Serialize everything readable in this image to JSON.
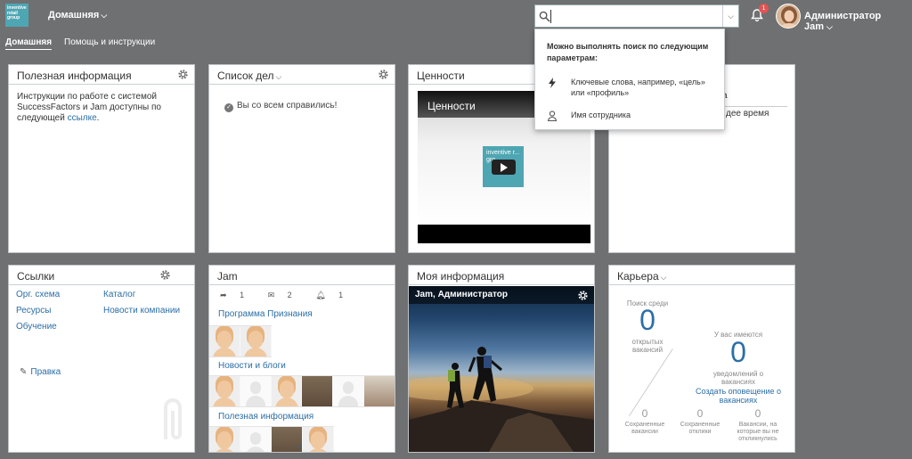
{
  "header": {
    "logo_text": "inventive retail group",
    "home_menu": "Домашняя",
    "search": {
      "value": "",
      "placeholder": ""
    },
    "notification_count": "1",
    "user_name": "Администратор Jam"
  },
  "subnav": {
    "home": "Домашняя",
    "help": "Помощь и инструкции"
  },
  "search_dropdown": {
    "hint": "Можно выполнять поиск по следующим параметрам:",
    "options": [
      {
        "icon": "lightning-icon",
        "text": "Ключевые слова, например, «цель» или «профиль»"
      },
      {
        "icon": "person-icon",
        "text": "Имя сотрудника"
      }
    ]
  },
  "tiles": {
    "useful_info": {
      "title": "Полезная информация",
      "text": "Инструкции по работе с системой SuccessFactors и Jam доступны по следующей ",
      "link": "ссылке",
      "text_end": "."
    },
    "todo": {
      "title": "Список дел",
      "message": "Вы со всем справились!"
    },
    "values": {
      "title": "Ценности",
      "video_title": "Ценности",
      "video_logo": "inventive r... gro..."
    },
    "hidden_tile": {
      "partial_text_1": "а",
      "partial_text_2": "дее время"
    },
    "links": {
      "title": "Ссылки",
      "items": [
        "Орг. схема",
        "Каталог",
        "Ресурсы",
        "Новости компании",
        "Обучение"
      ],
      "edit_label": "Правка"
    },
    "jam": {
      "title": "Jam",
      "shares": "1",
      "messages": "2",
      "alerts": "1",
      "sections": [
        "Программа Признания",
        "Новости и блоги",
        "Полезная информация"
      ]
    },
    "my_info": {
      "title": "Моя информация",
      "card_title": "Jam, Администратор"
    },
    "career": {
      "title": "Карьера",
      "search_label": "Поиск среди",
      "open_count": "0",
      "open_label": "открытых вакансий",
      "you_have": "У вас имеются",
      "alerts_count": "0",
      "alerts_label": "уведомлений о вакансиях",
      "create_alert": "Создать оповещение о вакансиях",
      "saved_jobs_count": "0",
      "saved_jobs_label": "Сохраненные вакансии",
      "saved_apps_count": "0",
      "saved_apps_label": "Сохраненные отклики",
      "not_applied_count": "0",
      "not_applied_label": "Вакансии, на которые вы не откликнулись"
    }
  },
  "colors": {
    "background": "#6e7072",
    "link": "#2b6ea7",
    "brand": "#4fa6b3",
    "badge": "#e35353"
  }
}
